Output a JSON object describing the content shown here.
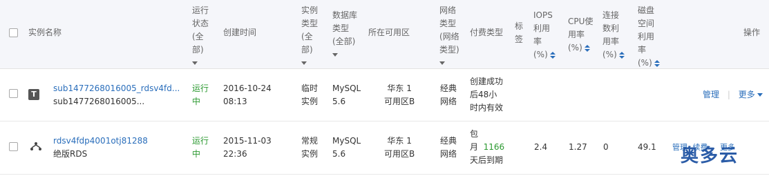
{
  "header": {
    "instance_name": "实例名称",
    "status": [
      "运行",
      "状态",
      "(全",
      "部)"
    ],
    "created": "创建时间",
    "instance_type": [
      "实例",
      "类型",
      "(全",
      "部)"
    ],
    "db_type": [
      "数据库",
      "类型",
      "(全部)"
    ],
    "zone": "所在可用区",
    "network": [
      "网络",
      "类型",
      "(网络",
      "类型)"
    ],
    "pay": "付费类型",
    "tag": [
      "标",
      "签"
    ],
    "iops": [
      "IOPS",
      "利用",
      "率",
      "(%)"
    ],
    "cpu": [
      "CPU使",
      "用率",
      "(%)"
    ],
    "conn": [
      "连接",
      "数利",
      "用率",
      "(%)"
    ],
    "disk": [
      "磁盘",
      "空间",
      "利用",
      "率",
      "(%)"
    ],
    "ops": "操作"
  },
  "rows": [
    {
      "icon": "T",
      "id": "sub1477268016005_rdsv4fd...",
      "desc": "sub1477268016005...",
      "status": [
        "运行",
        "中"
      ],
      "created": [
        "2016-10-24",
        "08:13"
      ],
      "type": [
        "临时",
        "实例"
      ],
      "db": [
        "MySQL",
        "5.6"
      ],
      "zone": [
        "华东 1",
        "可用区B"
      ],
      "network": [
        "经典",
        "网络"
      ],
      "pay": [
        "创建成功",
        "后48小",
        "时内有效"
      ],
      "iops": "",
      "cpu": "",
      "conn": "",
      "disk": "",
      "op_manage": "管理",
      "op_sep": "|",
      "op_more": "更多"
    },
    {
      "icon": "cluster-icon",
      "id": "rdsv4fdp4001otj81288",
      "desc": "绝版RDS",
      "status": [
        "运行",
        "中"
      ],
      "created": [
        "2015-11-03",
        "22:36"
      ],
      "type": [
        "常规",
        "实例"
      ],
      "db": [
        "MySQL",
        "5.6"
      ],
      "zone": [
        "华东 1",
        "可用区B"
      ],
      "network": [
        "经典",
        "网络"
      ],
      "pay_prefix": [
        "包",
        "月"
      ],
      "pay_days": "1166",
      "pay_suffix": "天后到期",
      "iops": "2.4",
      "cpu": "1.27",
      "conn": "0",
      "disk": "49.1",
      "op_manage": "管理",
      "op_renew": "续费",
      "op_more": "更多"
    }
  ],
  "watermark": "奥多云",
  "colors": {
    "link": "#2a6ebb",
    "status_green": "#2b9930",
    "header_bg": "#f5f6fa"
  }
}
